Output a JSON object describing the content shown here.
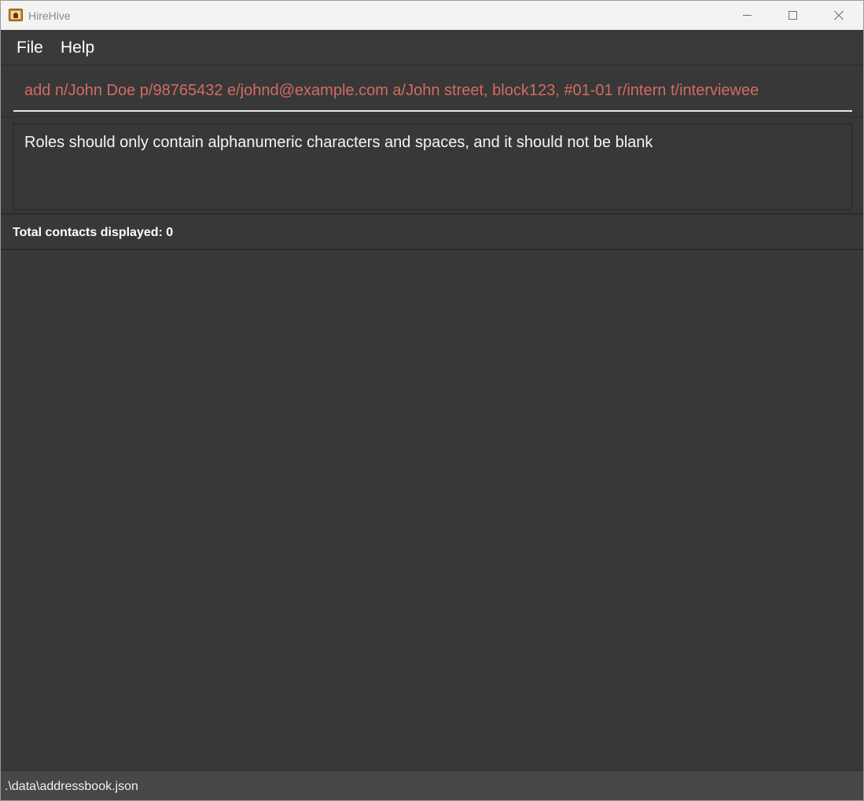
{
  "window": {
    "title": "HireHive",
    "icon": "address-book-icon"
  },
  "menu": {
    "file_label": "File",
    "help_label": "Help"
  },
  "command": {
    "value": "add n/John Doe p/98765432 e/johnd@example.com a/John street, block123, #01-01 r/intern t/interviewee",
    "error_color": "#d26b62"
  },
  "result": {
    "message": "Roles should only contain alphanumeric characters and spaces, and it should not be blank"
  },
  "list": {
    "header": "Total contacts displayed: 0"
  },
  "status": {
    "path": ".\\data\\addressbook.json"
  },
  "colors": {
    "background": "#383838",
    "titlebar": "#f3f3f3",
    "statusbar": "#474747"
  }
}
